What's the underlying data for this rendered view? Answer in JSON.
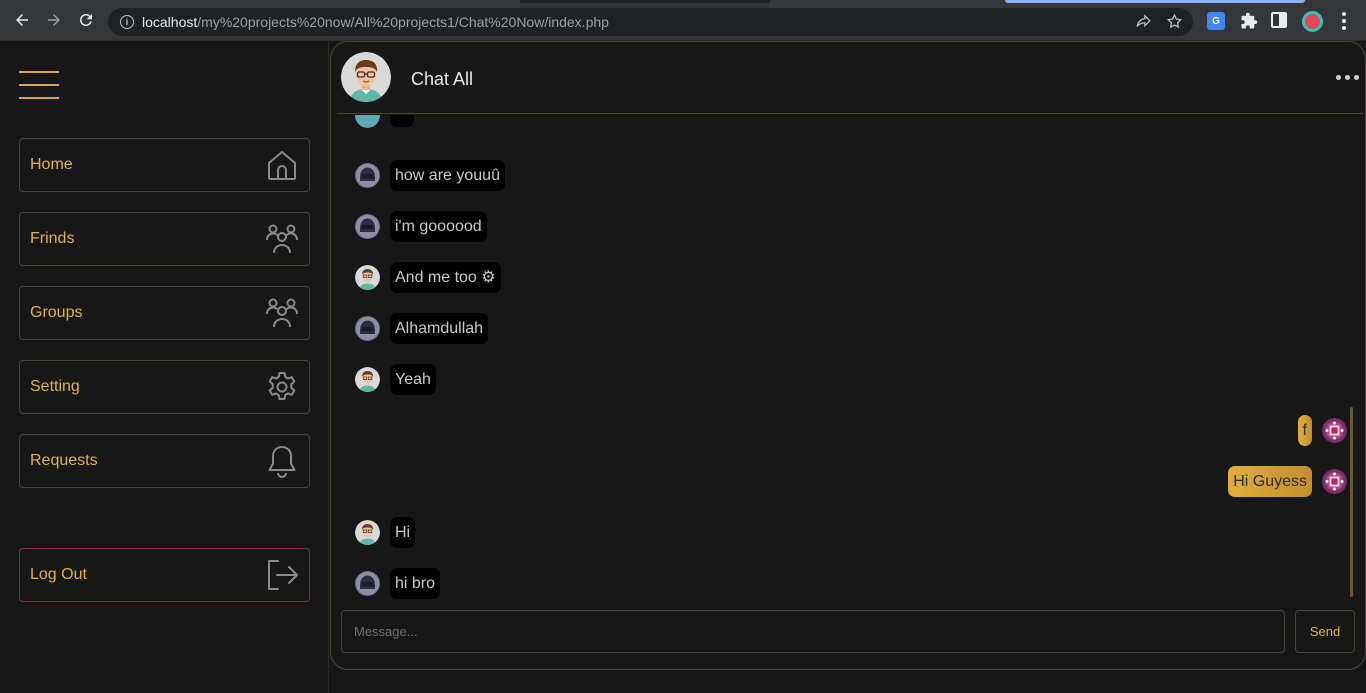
{
  "browser": {
    "url_host": "localhost",
    "url_path": "/my%20projects%20now/All%20projects1/Chat%20Now/index.php"
  },
  "sidebar": {
    "items": [
      {
        "label": "Home",
        "icon": "home-icon"
      },
      {
        "label": "Frinds",
        "icon": "friends-icon"
      },
      {
        "label": "Groups",
        "icon": "groups-icon"
      },
      {
        "label": "Setting",
        "icon": "gear-icon"
      },
      {
        "label": "Requests",
        "icon": "bell-icon"
      }
    ],
    "logout": {
      "label": "Log Out",
      "icon": "logout-icon"
    }
  },
  "chat": {
    "title": "Chat All",
    "messages": [
      {
        "text": "how are youuû",
        "sender": "helmet-user",
        "direction": "in"
      },
      {
        "text": "i'm goooood",
        "sender": "helmet-user",
        "direction": "in"
      },
      {
        "text": "And me too ⚙",
        "sender": "glasses-user",
        "direction": "in"
      },
      {
        "text": "Alhamdullah",
        "sender": "helmet-user",
        "direction": "in"
      },
      {
        "text": "Yeah",
        "sender": "glasses-user",
        "direction": "in"
      },
      {
        "text": "f",
        "sender": "me",
        "direction": "out"
      },
      {
        "text": "Hi Guyess",
        "sender": "me",
        "direction": "out"
      },
      {
        "text": "Hi",
        "sender": "glasses-user",
        "direction": "in"
      },
      {
        "text": "hi bro",
        "sender": "helmet-user",
        "direction": "in"
      }
    ],
    "composer": {
      "placeholder": "Message...",
      "send_label": "Send"
    }
  },
  "colors": {
    "accent": "#e3b341",
    "background": "#171717",
    "border": "#4a4230",
    "logout_border": "#8a2a2a"
  }
}
